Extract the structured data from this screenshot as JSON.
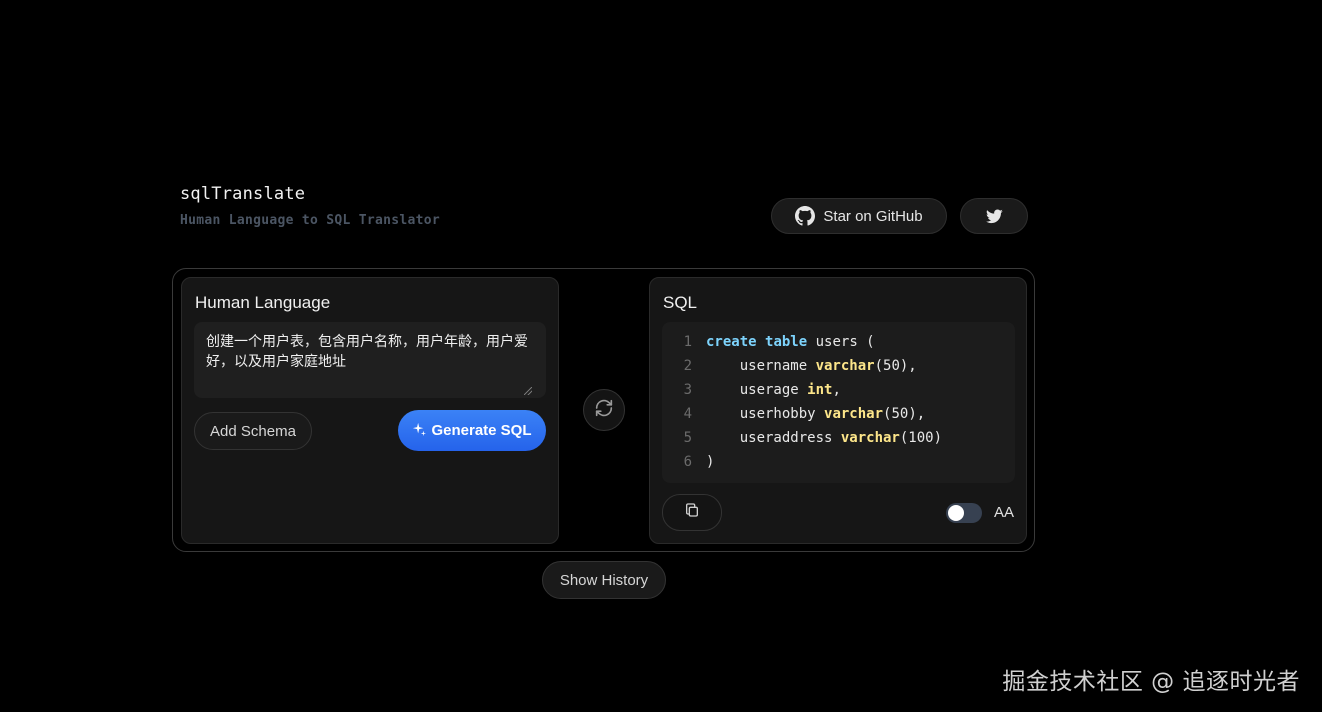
{
  "header": {
    "title": "sqlTranslate",
    "subtitle": "Human Language to SQL Translator",
    "github_label": "Star on GitHub",
    "twitter_icon": "twitter-icon",
    "github_icon": "github-icon"
  },
  "input_panel": {
    "title": "Human Language",
    "prompt": "创建一个用户表，包含用户名称，用户年龄，用户爱好，以及用户家庭地址",
    "add_schema_label": "Add Schema",
    "generate_label": "Generate SQL",
    "generate_icon": "sparkle-icon"
  },
  "swap": {
    "icon": "swap-arrows-icon"
  },
  "output_panel": {
    "title": "SQL",
    "code_lines": [
      {
        "n": "1",
        "text": "create table users ("
      },
      {
        "n": "2",
        "text": "    username varchar(50),"
      },
      {
        "n": "3",
        "text": "    userage int,"
      },
      {
        "n": "4",
        "text": "    userhobby varchar(50),"
      },
      {
        "n": "5",
        "text": "    useraddress varchar(100)"
      },
      {
        "n": "6",
        "text": ")"
      }
    ],
    "copy_icon": "copy-icon",
    "toggle_on": false,
    "toggle_label": "AA"
  },
  "history_label": "Show History",
  "watermark": "掘金技术社区 @ 追逐时光者",
  "colors": {
    "background": "#000000",
    "accent_blue": "#3b82f6",
    "keyword": "#7dd3fc",
    "type": "#fde68a"
  }
}
